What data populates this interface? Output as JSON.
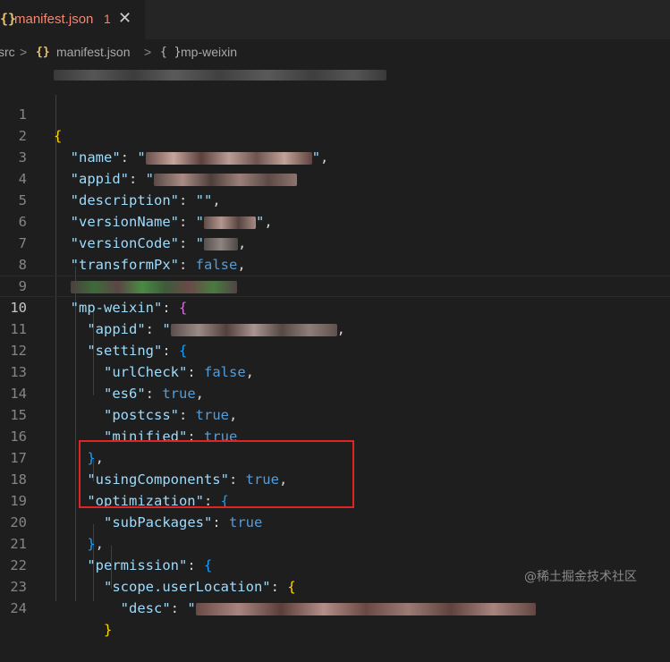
{
  "tab": {
    "file_label": "manifest.json",
    "problem_count": "1",
    "icon": "{}",
    "close_glyph": "✕"
  },
  "breadcrumb": {
    "root": "src",
    "sep1": ">",
    "file_icon": "{}",
    "file": "manifest.json",
    "sep2": ">",
    "obj_icon": "{ }",
    "obj": "mp-weixin"
  },
  "editor": {
    "current_line": 10,
    "lines": [
      {
        "n": "1"
      },
      {
        "n": "2"
      },
      {
        "n": "3"
      },
      {
        "n": "4"
      },
      {
        "n": "5"
      },
      {
        "n": "6"
      },
      {
        "n": "7"
      },
      {
        "n": "8"
      },
      {
        "n": "9"
      },
      {
        "n": "10"
      },
      {
        "n": "11"
      },
      {
        "n": "12"
      },
      {
        "n": "13"
      },
      {
        "n": "14"
      },
      {
        "n": "15"
      },
      {
        "n": "16"
      },
      {
        "n": "17"
      },
      {
        "n": "18"
      },
      {
        "n": "19"
      },
      {
        "n": "20"
      },
      {
        "n": "21"
      },
      {
        "n": "22"
      },
      {
        "n": "23"
      },
      {
        "n": "24"
      }
    ],
    "tokens": {
      "l1_open": "{",
      "l2_key": "\"name\"",
      "l3_key": "\"appid\"",
      "l4_key": "\"description\"",
      "l4_val": "\"\"",
      "l5_key": "\"versionName\"",
      "l6_key": "\"versionCode\"",
      "l7_key": "\"transformPx\"",
      "l7_val": "false",
      "l9_key": "\"mp-weixin\"",
      "l9_open": "{",
      "l10_key": "\"appid\"",
      "l11_key": "\"setting\"",
      "l11_open": "{",
      "l12_key": "\"urlCheck\"",
      "l12_val": "false",
      "l13_key": "\"es6\"",
      "l13_val": "true",
      "l14_key": "\"postcss\"",
      "l14_val": "true",
      "l15_key": "\"minified\"",
      "l15_val": "true",
      "l16_close": "}",
      "l17_key": "\"usingComponents\"",
      "l17_val": "true",
      "l18_key": "\"optimization\"",
      "l18_open": "{",
      "l19_key": "\"subPackages\"",
      "l19_val": "true",
      "l20_close": "}",
      "l21_key": "\"permission\"",
      "l21_open": "{",
      "l22_key": "\"scope.userLocation\"",
      "l22_open": "{",
      "l23_key": "\"desc\"",
      "l24_close": "}",
      "colon": ": ",
      "comma": ",",
      "quote": "\""
    }
  },
  "watermark": "@稀土掘金技术社区",
  "colors": {
    "background": "#1e1e1e",
    "key": "#9cdcfe",
    "boolean": "#569cd6",
    "error_tab": "#f48771",
    "highlight_box": "#e02424"
  }
}
